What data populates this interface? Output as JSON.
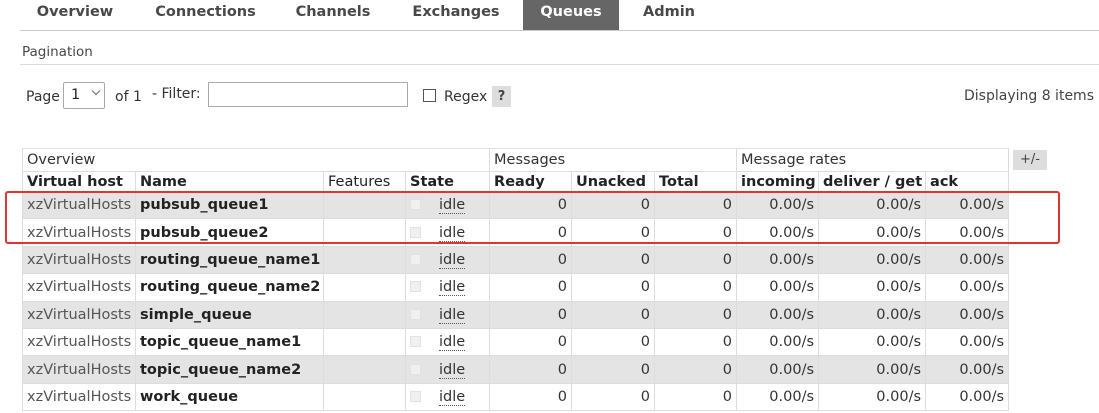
{
  "nav": {
    "tabs": [
      {
        "label": "Overview",
        "active": false
      },
      {
        "label": "Connections",
        "active": false
      },
      {
        "label": "Channels",
        "active": false
      },
      {
        "label": "Exchanges",
        "active": false
      },
      {
        "label": "Queues",
        "active": true
      },
      {
        "label": "Admin",
        "active": false
      }
    ]
  },
  "pagination": {
    "title": "Pagination",
    "page_label": "Page",
    "page_value": "1",
    "of_label": "of 1",
    "filter_label": "- Filter:",
    "filter_value": "",
    "regex_label": "Regex",
    "regex_checked": false,
    "help_label": "?",
    "displaying": "Displaying 8 items"
  },
  "table": {
    "groups": [
      "Overview",
      "Messages",
      "Message rates"
    ],
    "columns_toggle": "+/-",
    "columns": [
      "Virtual host",
      "Name",
      "Features",
      "State",
      "Ready",
      "Unacked",
      "Total",
      "incoming",
      "deliver / get",
      "ack"
    ],
    "rows": [
      {
        "vhost": "xzVirtualHosts",
        "name": "pubsub_queue1",
        "features": "",
        "state": "idle",
        "ready": "0",
        "unacked": "0",
        "total": "0",
        "incoming": "0.00/s",
        "deliver": "0.00/s",
        "ack": "0.00/s"
      },
      {
        "vhost": "xzVirtualHosts",
        "name": "pubsub_queue2",
        "features": "",
        "state": "idle",
        "ready": "0",
        "unacked": "0",
        "total": "0",
        "incoming": "0.00/s",
        "deliver": "0.00/s",
        "ack": "0.00/s"
      },
      {
        "vhost": "xzVirtualHosts",
        "name": "routing_queue_name1",
        "features": "",
        "state": "idle",
        "ready": "0",
        "unacked": "0",
        "total": "0",
        "incoming": "0.00/s",
        "deliver": "0.00/s",
        "ack": "0.00/s"
      },
      {
        "vhost": "xzVirtualHosts",
        "name": "routing_queue_name2",
        "features": "",
        "state": "idle",
        "ready": "0",
        "unacked": "0",
        "total": "0",
        "incoming": "0.00/s",
        "deliver": "0.00/s",
        "ack": "0.00/s"
      },
      {
        "vhost": "xzVirtualHosts",
        "name": "simple_queue",
        "features": "",
        "state": "idle",
        "ready": "0",
        "unacked": "0",
        "total": "0",
        "incoming": "0.00/s",
        "deliver": "0.00/s",
        "ack": "0.00/s"
      },
      {
        "vhost": "xzVirtualHosts",
        "name": "topic_queue_name1",
        "features": "",
        "state": "idle",
        "ready": "0",
        "unacked": "0",
        "total": "0",
        "incoming": "0.00/s",
        "deliver": "0.00/s",
        "ack": "0.00/s"
      },
      {
        "vhost": "xzVirtualHosts",
        "name": "topic_queue_name2",
        "features": "",
        "state": "idle",
        "ready": "0",
        "unacked": "0",
        "total": "0",
        "incoming": "0.00/s",
        "deliver": "0.00/s",
        "ack": "0.00/s"
      },
      {
        "vhost": "xzVirtualHosts",
        "name": "work_queue",
        "features": "",
        "state": "idle",
        "ready": "0",
        "unacked": "0",
        "total": "0",
        "incoming": "0.00/s",
        "deliver": "0.00/s",
        "ack": "0.00/s"
      }
    ]
  },
  "colors": {
    "active_tab_bg": "#666666",
    "highlight_border": "#e53333",
    "row_stripe": "#e4e4e4"
  }
}
